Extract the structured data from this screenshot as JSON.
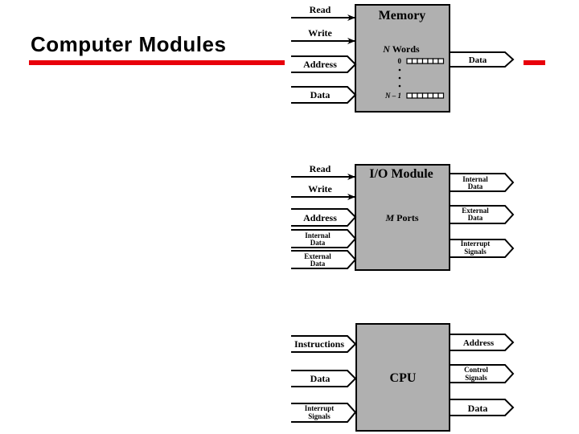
{
  "slide": {
    "title": "Computer Modules",
    "accent_color": "#e8000b"
  },
  "memory": {
    "title": "Memory",
    "inputs_arrows": [
      {
        "label": "Read"
      },
      {
        "label": "Write"
      }
    ],
    "inputs_chevrons": [
      {
        "label": "Address"
      },
      {
        "label": "Data"
      }
    ],
    "words_label_var": "N",
    "words_label_text": " Words",
    "row_first_label": "0",
    "row_last_label": "N – 1",
    "cells_per_row": 7,
    "outputs": [
      {
        "label": "Data"
      }
    ]
  },
  "io": {
    "title": "I/O Module",
    "inputs_arrows": [
      {
        "label": "Read"
      },
      {
        "label": "Write"
      }
    ],
    "inputs_chevrons": [
      {
        "lines": [
          "Address"
        ]
      },
      {
        "lines": [
          "Internal",
          "Data"
        ]
      },
      {
        "lines": [
          "External",
          "Data"
        ]
      }
    ],
    "ports_label_var": "M",
    "ports_label_text": " Ports",
    "outputs": [
      {
        "lines": [
          "Internal",
          "Data"
        ]
      },
      {
        "lines": [
          "External",
          "Data"
        ]
      },
      {
        "lines": [
          "Interrupt",
          "Signals"
        ]
      }
    ]
  },
  "cpu": {
    "title": "CPU",
    "inputs_chevrons": [
      {
        "lines": [
          "Instructions"
        ]
      },
      {
        "lines": [
          "Data"
        ]
      },
      {
        "lines": [
          "Interrupt",
          "Signals"
        ]
      }
    ],
    "outputs": [
      {
        "lines": [
          "Address"
        ]
      },
      {
        "lines": [
          "Control",
          "Signals"
        ]
      },
      {
        "lines": [
          "Data"
        ]
      }
    ]
  },
  "colors": {
    "box_fill": "#b0b0b0",
    "stroke": "#000000"
  }
}
